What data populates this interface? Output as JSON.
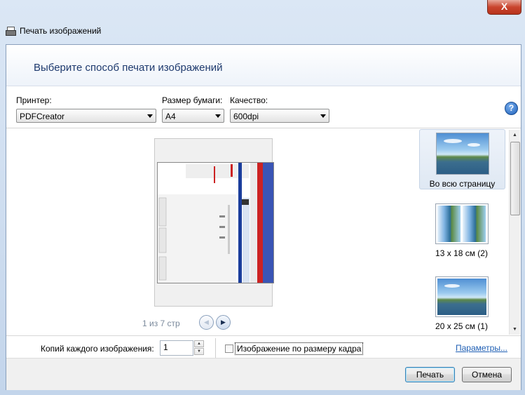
{
  "window": {
    "title": "Печать изображений",
    "close_glyph": "X"
  },
  "heading": "Выберите способ печати изображений",
  "options": {
    "printer_label": "Принтер:",
    "printer_value": "PDFCreator",
    "paper_label": "Размер бумаги:",
    "paper_value": "A4",
    "quality_label": "Качество:",
    "quality_value": "600dpi"
  },
  "help_glyph": "?",
  "preview": {
    "page_indicator": "1 из 7 стр"
  },
  "layouts": [
    {
      "label": "Во всю страницу",
      "selected": true
    },
    {
      "label": "13 x 18 см (2)",
      "selected": false
    },
    {
      "label": "20 x 25 см (1)",
      "selected": false
    }
  ],
  "copies": {
    "label": "Копий каждого изображения:",
    "value": "1"
  },
  "fit_frame": {
    "label": "Изображение по размеру кадра",
    "checked": false
  },
  "params_link": "Параметры...",
  "buttons": {
    "print": "Печать",
    "cancel": "Отмена"
  },
  "colors": {
    "heading": "#1e3a6e",
    "link": "#1f5fb4",
    "accent": "#3c7fb1"
  }
}
